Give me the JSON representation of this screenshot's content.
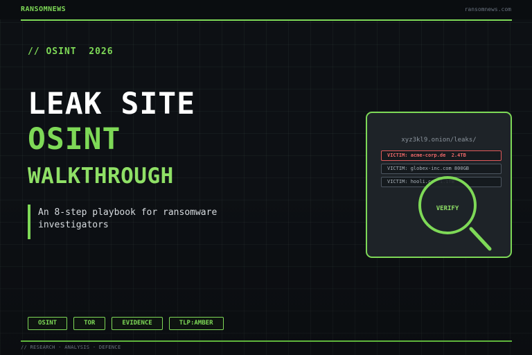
{
  "header": {
    "brand": "RANSOMNEWS",
    "domain": "ransomnews.com"
  },
  "hero": {
    "kicker": "// OSINT  2026",
    "title_line1": "LEAK SITE",
    "title_line2": "OSINT",
    "title_line3": "WALKTHROUGH",
    "subtitle": "An 8-step playbook for ransomware investigators"
  },
  "tags": [
    "OSINT",
    "TOR",
    "EVIDENCE",
    "TLP:AMBER"
  ],
  "illustration": {
    "url": "xyz3kl9.onion/leaks/",
    "rows": [
      "VICTIM: acme-corp.de  2.4TB",
      "VICTIM: globex-inc.com 800GB",
      "VICTIM: hooli.co  1.1TB"
    ],
    "button": "VERIFY",
    "icon": "magnifying-glass-icon"
  },
  "footer": {
    "text": "// RESEARCH · ANALYSIS · DEFENCE"
  },
  "colors": {
    "accent": "#7ed957",
    "alert": "#e05a5a",
    "background": "#0d1014"
  }
}
